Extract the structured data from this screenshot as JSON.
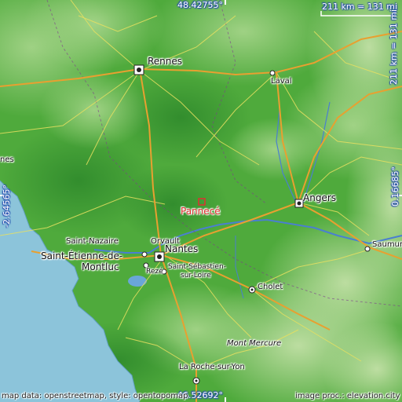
{
  "map": {
    "coords": {
      "top": "48.42755°",
      "bottom": "46.52692°",
      "left": "-2.64565°",
      "right": "0.16685°"
    },
    "scale": "211 km = 131 mi",
    "credit_left": "map data: openstreetmap, style: opentopomap",
    "credit_right": "image proc.: elevation.city",
    "highlight": {
      "label": "Pannecé",
      "color": "#e03030"
    },
    "cities": [
      {
        "id": "rennes",
        "label": "Rennes"
      },
      {
        "id": "laval",
        "label": "Laval"
      },
      {
        "id": "nes",
        "label": "nes"
      },
      {
        "id": "angers",
        "label": "Angers"
      },
      {
        "id": "saint-nazaire",
        "label": "Saint-Nazaire"
      },
      {
        "id": "orvault",
        "label": "Orvault"
      },
      {
        "id": "nantes",
        "label": "Nantes"
      },
      {
        "id": "saint-etienne",
        "label": "Saint-Étienne-de-"
      },
      {
        "id": "montluc",
        "label": "Montluc"
      },
      {
        "id": "reze",
        "label": "Rezé"
      },
      {
        "id": "saint-sebastien",
        "label": "Saint-Sébastien-"
      },
      {
        "id": "sur-loire",
        "label": "sur-Loire"
      },
      {
        "id": "saumur",
        "label": "Saumur"
      },
      {
        "id": "cholet",
        "label": "Cholet"
      },
      {
        "id": "mont-mercure",
        "label": "Mont Mercure"
      },
      {
        "id": "la-roche",
        "label": "La Roche-sur-Yon"
      }
    ],
    "colors": {
      "sea": "#8cc4da",
      "lowland": "#4faa3c",
      "upland": "#8fc87a",
      "water": "#4a7fd0",
      "motorway": "#e8a030",
      "road": "#f0e040"
    }
  }
}
